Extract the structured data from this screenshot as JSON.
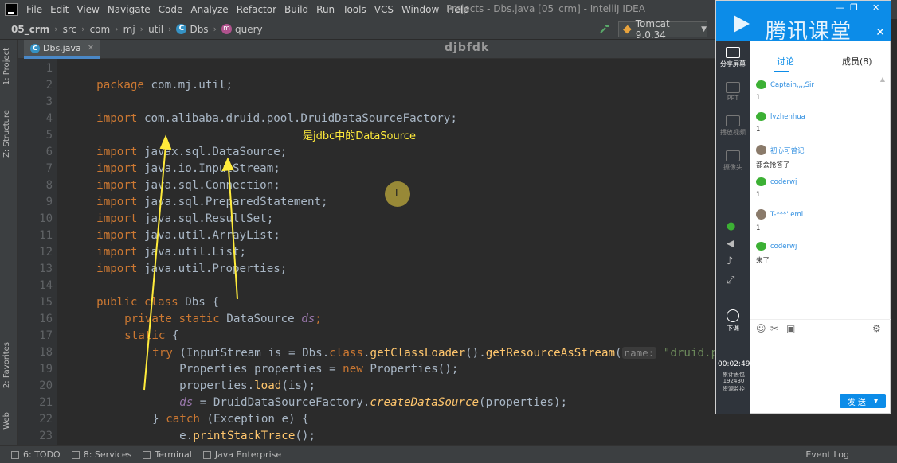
{
  "window_title": "Projects - Dbs.java [05_crm] - IntelliJ IDEA",
  "menu": [
    "File",
    "Edit",
    "View",
    "Navigate",
    "Code",
    "Analyze",
    "Refactor",
    "Build",
    "Run",
    "Tools",
    "VCS",
    "Window",
    "Help"
  ],
  "breadcrumb": {
    "project": "05_crm",
    "parts": [
      "src",
      "com",
      "mj",
      "util"
    ],
    "class_name": "Dbs",
    "method": "query"
  },
  "run_config": "Tomcat 9.0.34",
  "left_tabs": {
    "project": "1: Project",
    "structure": "Z: Structure",
    "favorites": "2: Favorites",
    "web": "Web"
  },
  "editor_tab": "Dbs.java",
  "watermark": "djbfdk",
  "code": {
    "l1": "package com.mj.util;",
    "l3": "com.alibaba.druid.pool.DruidDataSourceFactory;",
    "l5": "javax.sql.DataSource;",
    "l6": "java.io.InputStream;",
    "l7": "java.sql.Connection;",
    "l8": "java.sql.PreparedStatement;",
    "l9": "java.sql.ResultSet;",
    "l10": "java.util.ArrayList;",
    "l11": "java.util.List;",
    "l12": "java.util.Properties;",
    "kw_import": "import",
    "kw_package": "package",
    "l14_kw": "public class",
    "l14_rest": " Dbs {",
    "l15_kw": "private static",
    "l15_type": " DataSource ",
    "l15_field": "ds",
    "l15_end": ";",
    "l16_kw": "static",
    "l16_rest": " {",
    "l17_kw": "try",
    "l17_a": " (InputStream is = Dbs.",
    "l17_cls": "class",
    "l17_b": ".",
    "l17_m1": "getClassLoader",
    "l17_c": "().",
    "l17_m2": "getResourceAsStream",
    "l17_d": "(",
    "l17_hint": "name:",
    "l17_str": " \"druid.pro",
    "l18_a": "Properties properties = ",
    "l18_kw": "new",
    "l18_b": " Properties();",
    "l19_a": "properties.",
    "l19_m": "load",
    "l19_b": "(is);",
    "l20_f": "ds",
    "l20_a": " = DruidDataSourceFactory.",
    "l20_m": "createDataSource",
    "l20_b": "(properties);",
    "l21_a": "} ",
    "l21_kw": "catch",
    "l21_b": " (Exception e) {",
    "l22_a": "e.",
    "l22_m": "printStackTrace",
    "l22_b": "();",
    "l23": "}"
  },
  "line_numbers": [
    "1",
    "2",
    "3",
    "4",
    "5",
    "6",
    "7",
    "8",
    "9",
    "10",
    "11",
    "12",
    "13",
    "14",
    "15",
    "16",
    "17",
    "18",
    "19",
    "20",
    "21",
    "22",
    "23"
  ],
  "annotation": "是jdbc中的DataSource",
  "cursor_glyph": "I",
  "status_bar": {
    "todo": "6: TODO",
    "services": "8: Services",
    "terminal": "Terminal",
    "java_enterprise": "Java Enterprise",
    "event_log": "Event Log"
  },
  "classroom": {
    "title": "腾讯课堂",
    "tab_discussion": "讨论",
    "tab_members": "成员(8)",
    "side": {
      "share": "分享屏幕",
      "ppt": "PPT",
      "video": "播放视频",
      "camera": "摄像头",
      "leave": "下课",
      "timer": "00:02:49",
      "stats_1": "累计丢包",
      "stats_2": "192430",
      "stats_3": "资源监控"
    },
    "messages": [
      {
        "name": "Captain,,,,Sir",
        "text": "1"
      },
      {
        "name": "lvzhenhua",
        "text": "1"
      },
      {
        "name": "初心可曾记",
        "text": "都会抢答了"
      },
      {
        "name": "coderwj",
        "text": "1"
      },
      {
        "name": "T-***'     eml",
        "text": "1"
      },
      {
        "name": "coderwj",
        "text": "来了"
      }
    ],
    "send_label": "发 送"
  },
  "colors": {
    "keyword": "#cc7832",
    "plain": "#a9b7c6",
    "field": "#9876aa",
    "method": "#ffc66d",
    "string": "#6a8759",
    "annotation": "#ffeb3b",
    "qq_blue": "#0c8ce8"
  }
}
